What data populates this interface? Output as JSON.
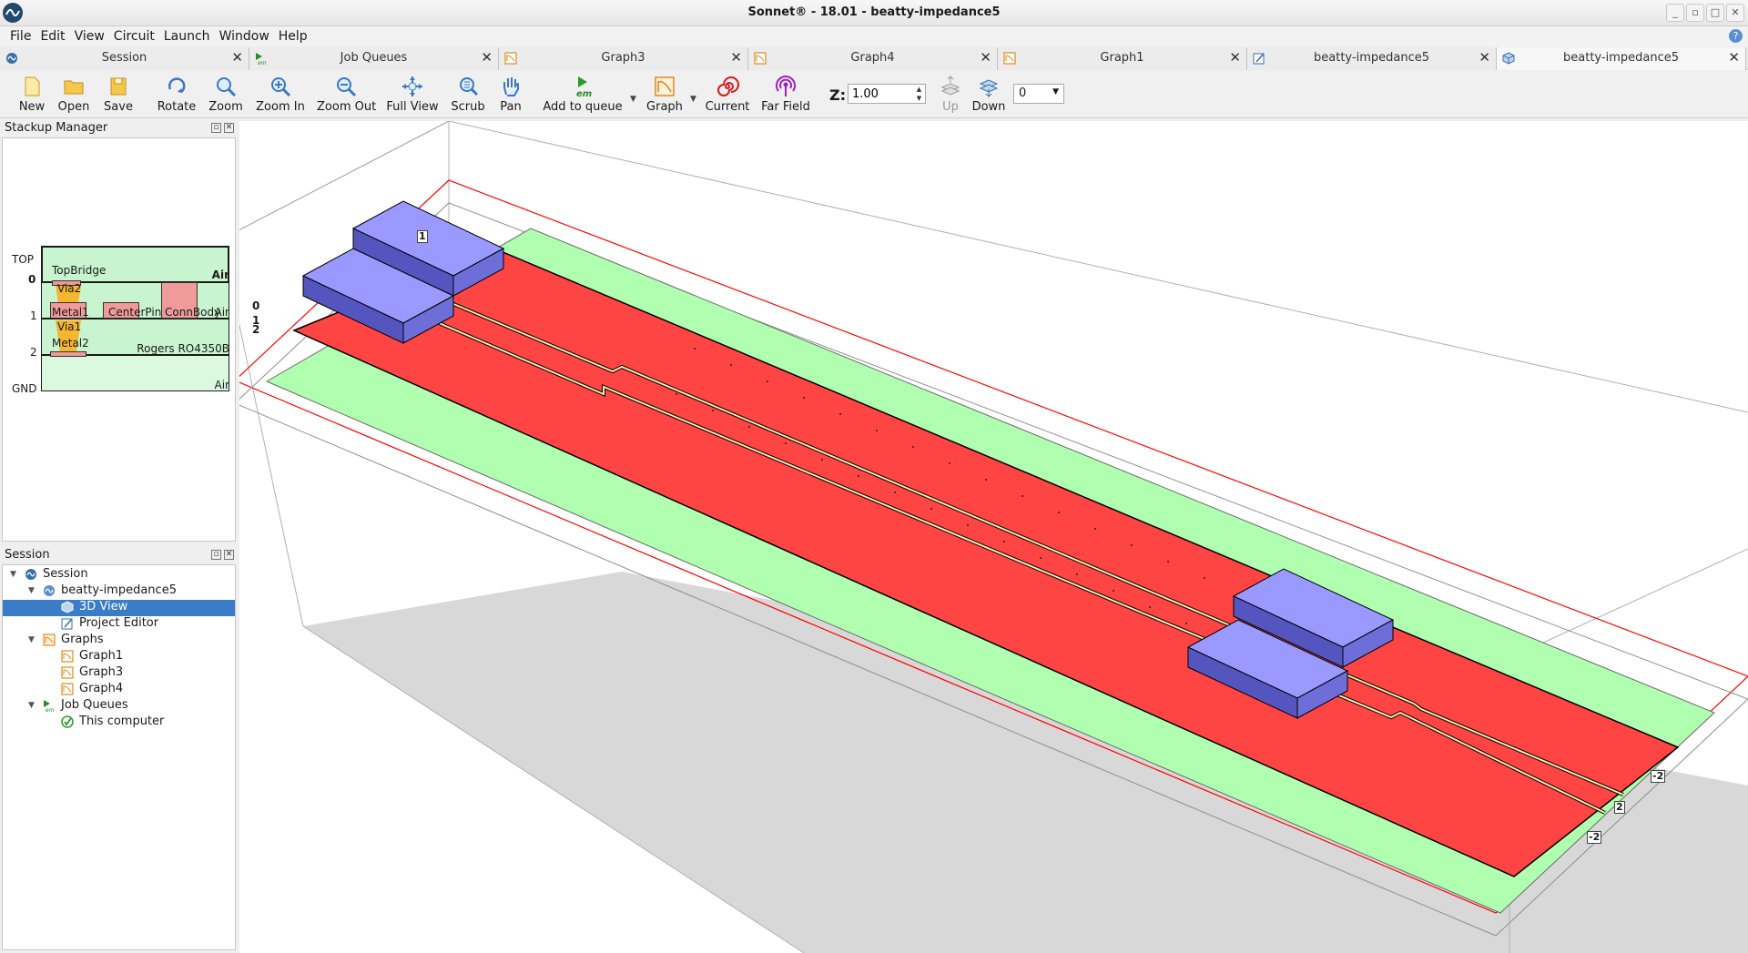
{
  "window": {
    "title": "Sonnet® - 18.01 - beatty-impedance5",
    "controls": [
      "_",
      "▫",
      "□",
      "✕"
    ]
  },
  "menu": {
    "items": [
      "File",
      "Edit",
      "View",
      "Circuit",
      "Launch",
      "Window",
      "Help"
    ],
    "help_badge": "?"
  },
  "tabs": [
    {
      "label": "Session",
      "icon": "sonnet-session-icon"
    },
    {
      "label": "Job Queues",
      "icon": "em-job-queue-icon"
    },
    {
      "label": "Graph3",
      "icon": "graph-icon"
    },
    {
      "label": "Graph4",
      "icon": "graph-icon"
    },
    {
      "label": "Graph1",
      "icon": "graph-icon"
    },
    {
      "label": "beatty-impedance5",
      "icon": "project-editor-icon"
    },
    {
      "label": "beatty-impedance5",
      "icon": "3d-view-icon",
      "active": true
    }
  ],
  "toolbar": {
    "new": "New",
    "open": "Open",
    "save": "Save",
    "rotate": "Rotate",
    "zoom": "Zoom",
    "zoom_in": "Zoom In",
    "zoom_out": "Zoom Out",
    "full_view": "Full View",
    "scrub": "Scrub",
    "pan": "Pan",
    "add_to_queue": "Add to queue",
    "graph": "Graph",
    "current": "Current",
    "far_field": "Far Field",
    "z_label": "Z:",
    "z_value": "1.00",
    "up": "Up",
    "down": "Down",
    "level_value": "0"
  },
  "stackup_manager": {
    "title": "Stackup Manager",
    "levels": [
      "TOP",
      "0",
      "1",
      "2",
      "GND"
    ],
    "layers": {
      "top_bridge": "TopBridge",
      "air_top": "Air",
      "via2": "Via2",
      "metal1": "Metal1",
      "center_pin": "CenterPin",
      "conn_body": "ConnBody",
      "air_1": "Air",
      "via1": "Via1",
      "metal2": "Metal2",
      "substrate": "Rogers RO4350B",
      "air_gnd": "Air"
    }
  },
  "session_panel": {
    "title": "Session",
    "tree": {
      "root": "Session",
      "project": "beatty-impedance5",
      "view_3d": "3D View",
      "project_editor": "Project Editor",
      "graphs": "Graphs",
      "graph1": "Graph1",
      "graph3": "Graph3",
      "graph4": "Graph4",
      "job_queues": "Job Queues",
      "this_computer": "This computer"
    }
  },
  "viewport": {
    "axis_levels": [
      "0",
      "1",
      "2"
    ],
    "port_labels": [
      "1",
      "-2",
      "2",
      "-2"
    ],
    "colors": {
      "metal_plane": "#ff4444",
      "substrate": "#b0ffb0",
      "connector_top": "#9999ff",
      "connector_side": "#5555c0",
      "box_outline": "#ff0000",
      "floor": "#d8d8d8"
    }
  }
}
